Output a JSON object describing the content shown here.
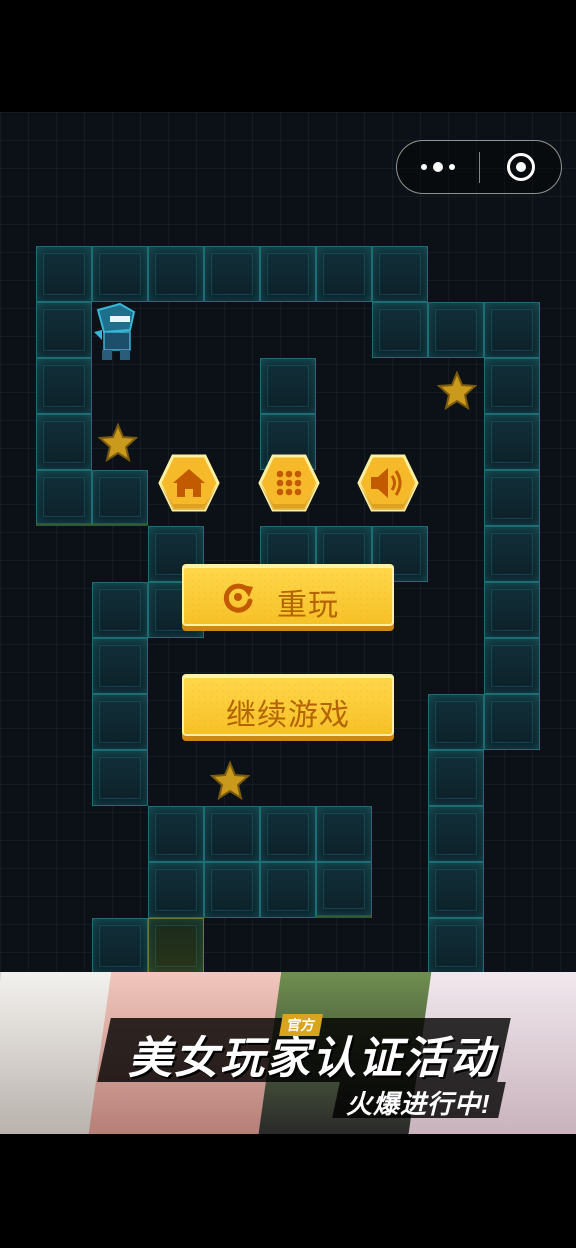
{
  "menu_capsule": {
    "more_icon": "more-dots-icon",
    "close_icon": "target-icon"
  },
  "pause_menu": {
    "icons": [
      "home-icon",
      "level-grid-icon",
      "sound-icon"
    ],
    "replay_label": "重玩",
    "replay_icon": "replay-icon",
    "continue_label": "继续游戏"
  },
  "banner": {
    "headline": "美女玩家认证活动",
    "tag": "官方",
    "subline": "火爆进行中!"
  },
  "colors": {
    "background": "#0b1116",
    "tile_edge": "#1f6d74",
    "button_yellow": "#f6c128",
    "button_text": "#b46400",
    "star": "#c99a1c"
  }
}
